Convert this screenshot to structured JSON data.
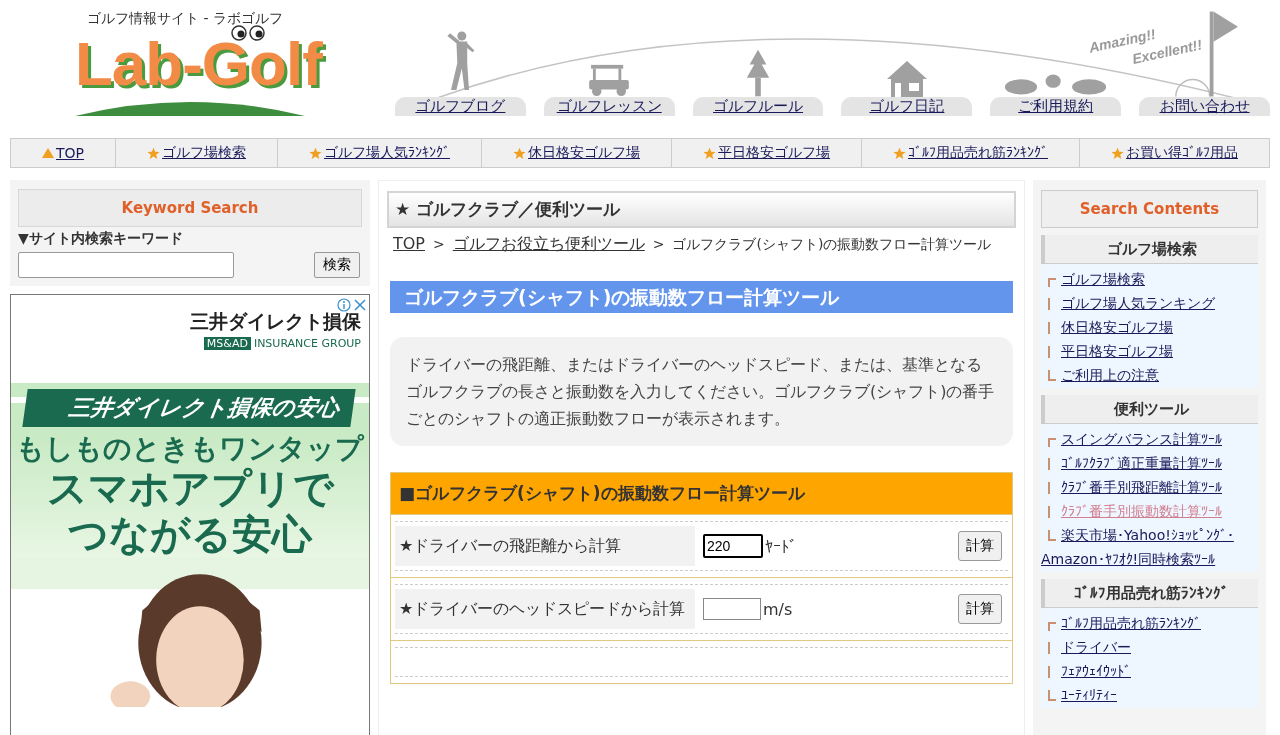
{
  "header": {
    "tagline": "ゴルフ情報サイト - ラボゴルフ",
    "logo": "Lab-Golf",
    "slogans": [
      "Amazing!!",
      "Excellent!!"
    ],
    "tabs": [
      {
        "label": "ゴルフブログ",
        "kind": "golfer"
      },
      {
        "label": "ゴルフレッスン",
        "kind": "cart"
      },
      {
        "label": "ゴルフルール",
        "kind": "tree"
      },
      {
        "label": "ゴルフ日記",
        "kind": "house"
      },
      {
        "label": "ご利用規約",
        "kind": "clouds"
      },
      {
        "label": "お問い合わせ",
        "kind": "flag"
      }
    ]
  },
  "nav": [
    {
      "label": "TOP",
      "kind": "triangle"
    },
    {
      "label": "ゴルフ場検索",
      "kind": "star"
    },
    {
      "label": "ゴルフ場人気ﾗﾝｷﾝｸﾞ",
      "kind": "star"
    },
    {
      "label": "休日格安ゴルフ場",
      "kind": "star"
    },
    {
      "label": "平日格安ゴルフ場",
      "kind": "star"
    },
    {
      "label": "ｺﾞﾙﾌ用品売れ筋ﾗﾝｷﾝｸﾞ",
      "kind": "star"
    },
    {
      "label": "お買い得ｺﾞﾙﾌ用品",
      "kind": "star"
    }
  ],
  "left": {
    "search_title": "Keyword Search",
    "search_label": "▼サイト内検索キーワード",
    "search_button": "検索",
    "ad": {
      "brand": "三井ダイレクト損保",
      "group_badge": "MS&AD",
      "group_text": "INSURANCE GROUP",
      "banner": "三井ダイレクト損保の安心",
      "lines": [
        "もしものときもワンタップ",
        "スマホアプリで",
        "つながる安心"
      ]
    }
  },
  "main": {
    "section_title": "★ ゴルフクラブ／便利ツール",
    "breadcrumb": [
      {
        "label": "TOP",
        "link": true
      },
      {
        "label": ">",
        "link": false
      },
      {
        "label": "ゴルフお役立ち便利ツール",
        "link": true
      },
      {
        "label": ">",
        "link": false
      },
      {
        "label": "ゴルフクラブ(シャフト)の振動数フロー計算ツール",
        "link": false
      }
    ],
    "title": "ゴルフクラブ(シャフト)の振動数フロー計算ツール",
    "description": "ドライバーの飛距離、またはドライバーのヘッドスピード、または、基準となるゴルフクラブの長さと振動数を入力してください。ゴルフクラブ(シャフト)の番手ごとのシャフトの適正振動数フローが表示されます。",
    "tool_title": "■ゴルフクラブ(シャフト)の振動数フロー計算ツール",
    "rows": [
      {
        "label": "★ドライバーの飛距離から計算",
        "value": "220",
        "unit": "ﾔｰﾄﾞ",
        "focused": true,
        "button": "計算"
      },
      {
        "label": "★ドライバーのヘッドスピードから計算",
        "value": "",
        "unit": "m/s",
        "focused": false,
        "button": "計算"
      }
    ]
  },
  "right": {
    "title": "Search Contents",
    "sections": [
      {
        "heading": "ゴルフ場検索",
        "items": [
          {
            "label": "ゴルフ場検索",
            "current": false
          },
          {
            "label": "ゴルフ場人気ランキング",
            "current": false
          },
          {
            "label": "休日格安ゴルフ場",
            "current": false
          },
          {
            "label": "平日格安ゴルフ場",
            "current": false
          },
          {
            "label": "ご利用上の注意",
            "current": false
          }
        ]
      },
      {
        "heading": "便利ツール",
        "items": [
          {
            "label": "スイングバランス計算ﾂｰﾙ",
            "current": false
          },
          {
            "label": "ｺﾞﾙﾌｸﾗﾌﾞ適正重量計算ﾂｰﾙ",
            "current": false
          },
          {
            "label": "ｸﾗﾌﾞ番手別飛距離計算ﾂｰﾙ",
            "current": false
          },
          {
            "label": "ｸﾗﾌﾞ番手別振動数計算ﾂｰﾙ",
            "current": true
          },
          {
            "label": "楽天市場･Yahoo!ｼｮｯﾋﾟﾝｸﾞ･Amazon･ﾔﾌｵｸ!同時検索ﾂｰﾙ",
            "current": false
          }
        ]
      },
      {
        "heading": "ｺﾞﾙﾌ用品売れ筋ﾗﾝｷﾝｸﾞ",
        "items": [
          {
            "label": "ｺﾞﾙﾌ用品売れ筋ﾗﾝｷﾝｸﾞ",
            "current": false
          },
          {
            "label": "ドライバー",
            "current": false
          },
          {
            "label": "ﾌｪｱｳｪｲｳｯﾄﾞ",
            "current": false
          },
          {
            "label": "ﾕｰﾃｨﾘﾃｨｰ",
            "current": false
          }
        ]
      }
    ]
  }
}
